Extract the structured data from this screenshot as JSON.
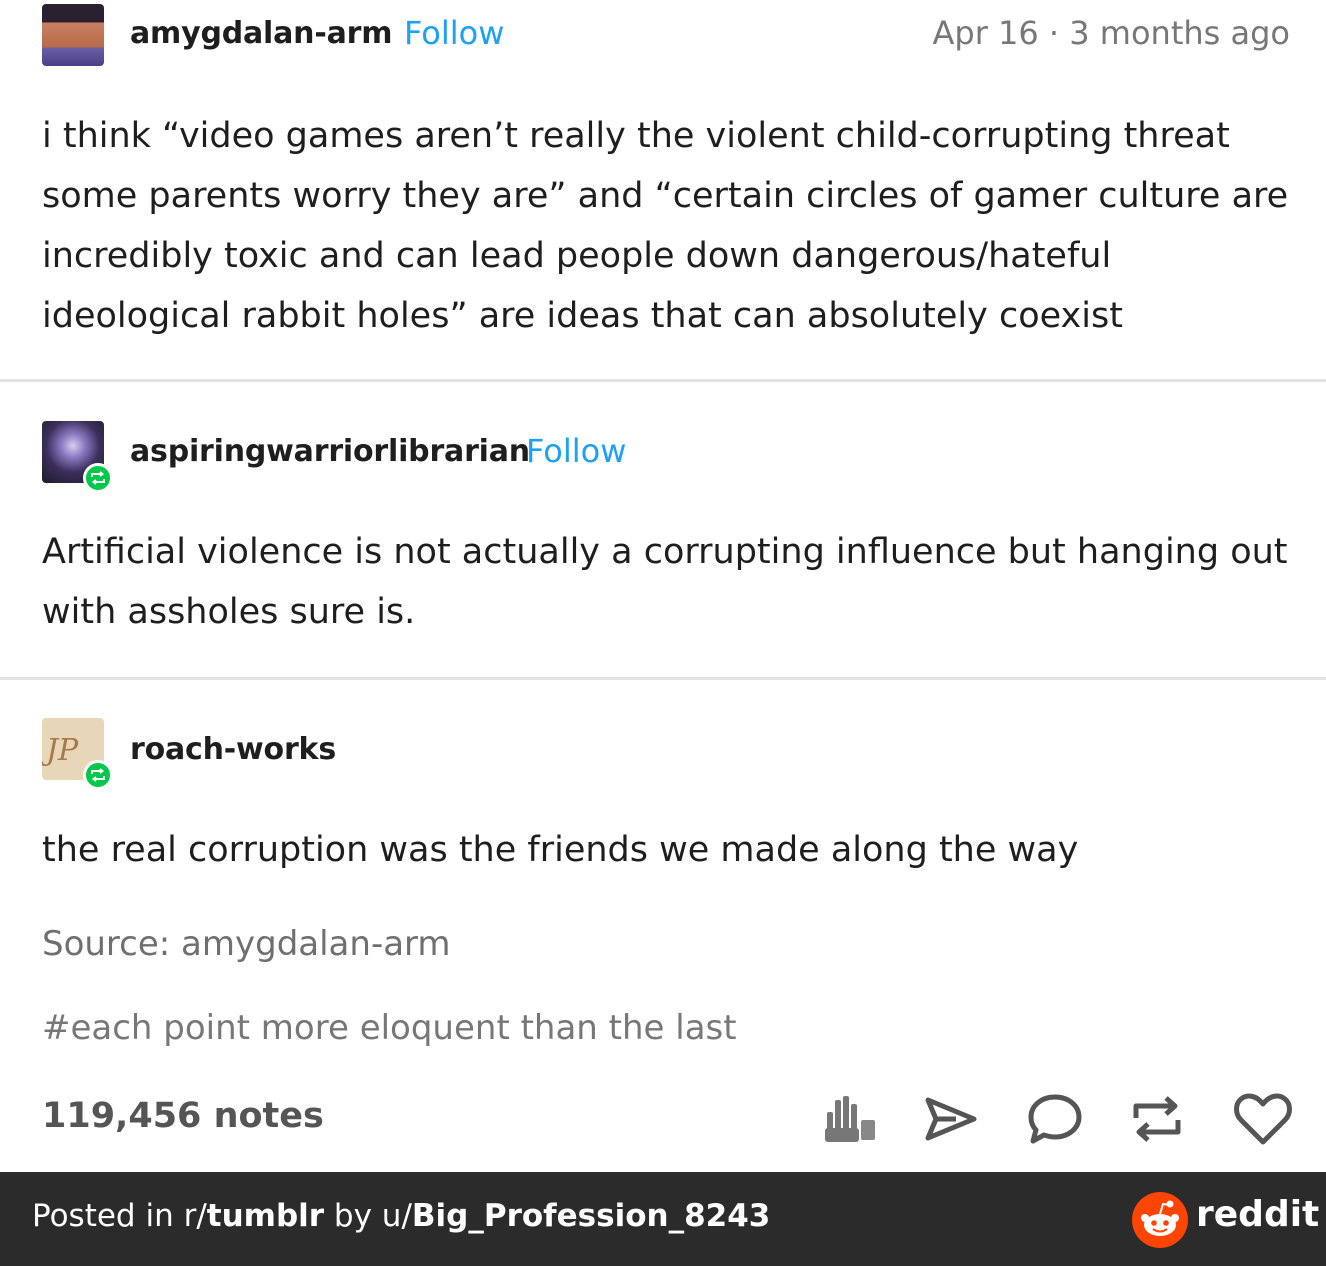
{
  "posts": [
    {
      "username": "amygdalan-arm",
      "follow_label": "Follow",
      "date": "Apr 16 · 3 months ago",
      "body": "i think “video games aren’t really the violent child-corrupting threat some parents worry they are” and “certain circles of gamer culture are incredibly toxic and can lead people down dangerous/hateful ideological rabbit holes” are ideas that can absolutely coexist"
    },
    {
      "username": "aspiringwarriorlibrarian",
      "follow_label": "Follow",
      "body": "Artificial violence is not actually a corrupting influence but hanging out with assholes sure is."
    },
    {
      "username": "roach-works",
      "body": "the real corruption was the friends we made along the way"
    }
  ],
  "source": "Source: amygdalan-arm",
  "tags": "#each point more eloquent than the last",
  "notes": "119,456 notes",
  "actions": [
    "hands-icon",
    "share-icon",
    "comment-icon",
    "reblog-icon",
    "like-icon"
  ],
  "footer": {
    "prefix": "Posted in r/",
    "subreddit": "tumblr",
    "by": " by u/",
    "user": "Big_Profession_8243",
    "brand": "reddit"
  },
  "colors": {
    "follow": "#1da1f2",
    "reblog_badge": "#00c84a",
    "footer_bg": "#2b2b2b",
    "reddit_orange": "#ff4500"
  }
}
